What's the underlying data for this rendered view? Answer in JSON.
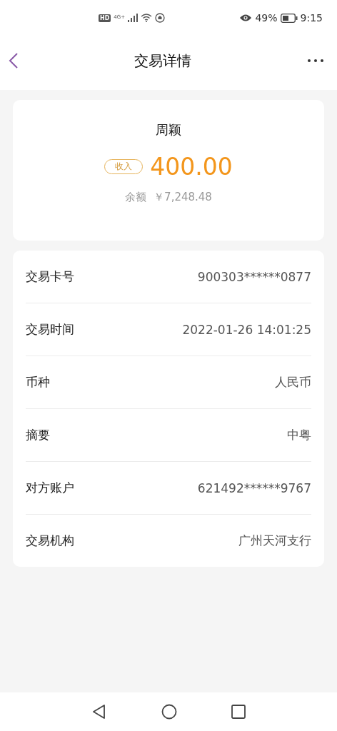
{
  "status_bar": {
    "network_badge": "HD",
    "network_type": "4G+",
    "battery_percent": "49%",
    "time": "9:15"
  },
  "header": {
    "title": "交易详情"
  },
  "summary": {
    "name": "周颖",
    "tag": "收入",
    "amount": "400.00",
    "balance_label": "余额",
    "balance": "￥7,248.48"
  },
  "details": [
    {
      "label": "交易卡号",
      "value": "900303******0877"
    },
    {
      "label": "交易时间",
      "value": "2022-01-26 14:01:25"
    },
    {
      "label": "币种",
      "value": "人民币"
    },
    {
      "label": "摘要",
      "value": "中粤"
    },
    {
      "label": "对方账户",
      "value": "621492******9767"
    },
    {
      "label": "交易机构",
      "value": "广州天河支行"
    }
  ]
}
